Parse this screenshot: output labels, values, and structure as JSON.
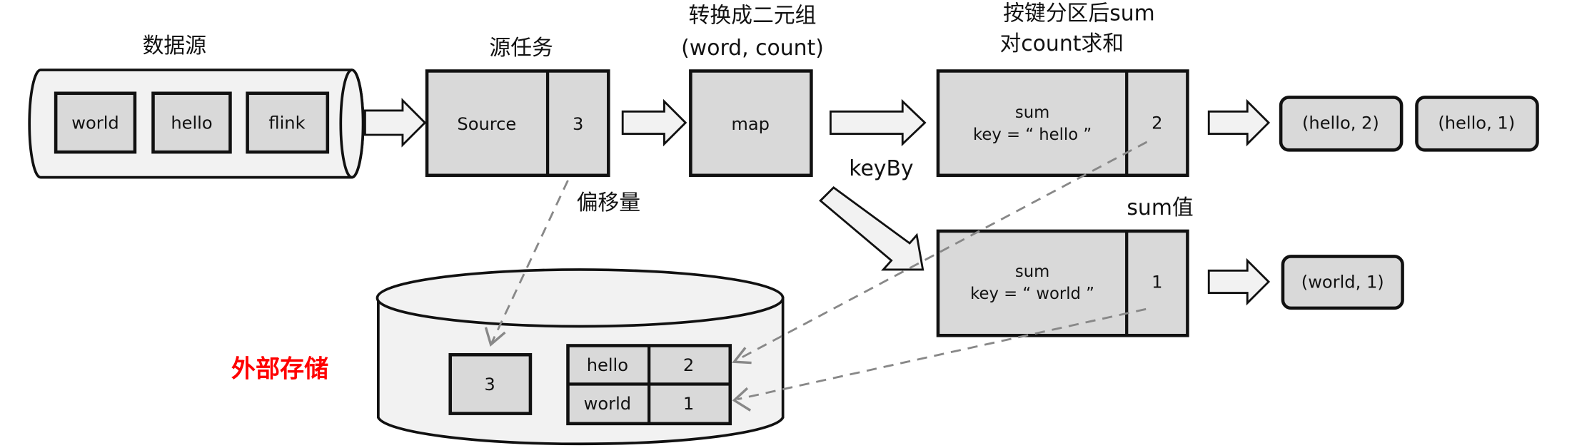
{
  "labels": {
    "data_source": "数据源",
    "source_task": "源任务",
    "transform_line1": "转换成二元组",
    "transform_line2": "(word, count)",
    "partition_line1": "按键分区后sum",
    "partition_line2": "对count求和",
    "offset": "偏移量",
    "key_by": "keyBy",
    "sum_value": "sum值",
    "external_storage": "外部存储"
  },
  "data_source_items": [
    "world",
    "hello",
    "flink"
  ],
  "source_task": {
    "name": "Source",
    "offset": "3"
  },
  "map_task": {
    "name": "map"
  },
  "sum_tasks": [
    {
      "line1": "sum",
      "line2": "key = “ hello ”",
      "value": "2"
    },
    {
      "line1": "sum",
      "line2": "key = “ world ”",
      "value": "1"
    }
  ],
  "outputs": {
    "hello": [
      "(hello, 2)",
      "(hello, 1)"
    ],
    "world": [
      "(world, 1)"
    ]
  },
  "storage": {
    "offset": "3",
    "table": [
      {
        "key": "hello",
        "value": "2"
      },
      {
        "key": "world",
        "value": "1"
      }
    ]
  },
  "colors": {
    "box_fill": "#d9d9d9",
    "light_fill": "#f2f2f2",
    "stroke": "#111111",
    "dashed_line": "#888888",
    "highlight_label": "#ff0000"
  }
}
